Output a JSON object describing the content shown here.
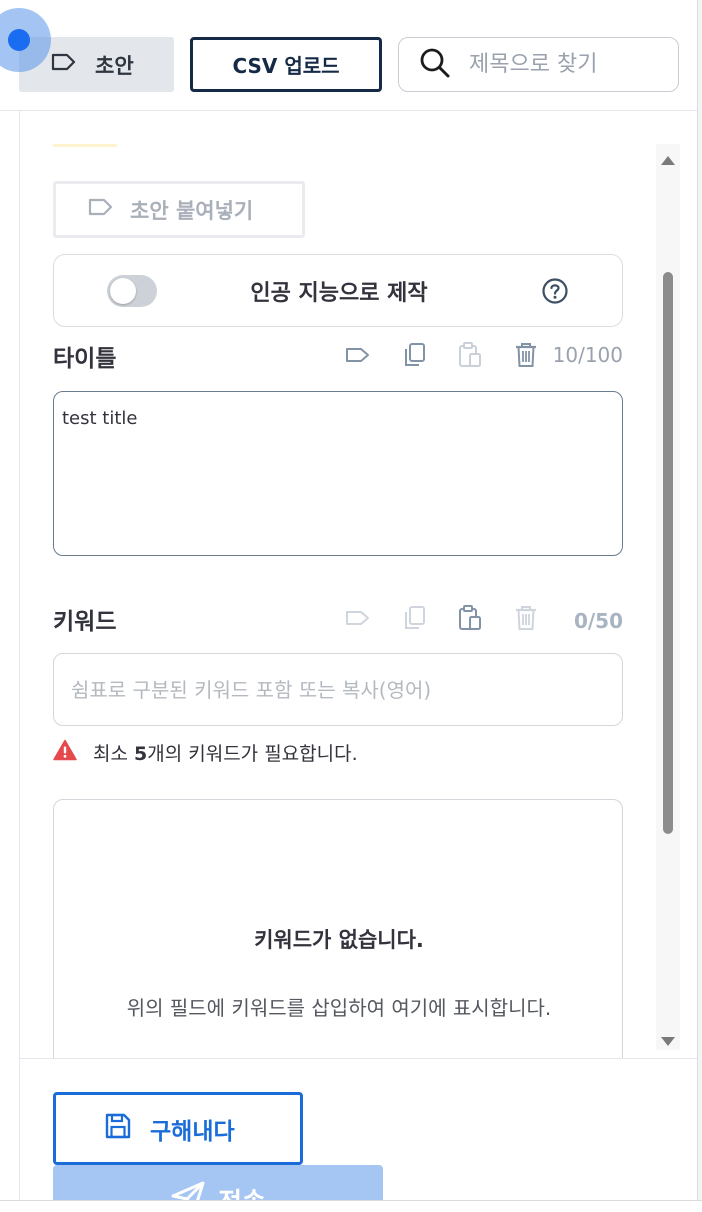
{
  "toolbar": {
    "draft_label": "초안",
    "csv_label": "CSV 업로드",
    "search_placeholder": "제목으로 찾기"
  },
  "draft_tools": {
    "paste_draft_label": "초안 붙여넣기"
  },
  "ai": {
    "label": "인공 지능으로 제작",
    "enabled": false
  },
  "title_section": {
    "heading": "타이틀",
    "counter": "10/100",
    "value": "test title"
  },
  "keyword_section": {
    "heading": "키워드",
    "counter": "0/50",
    "placeholder": "쉼표로 구분된 키워드 포함 또는 복사(영어)",
    "warning_prefix": "최소 ",
    "warning_count": "5",
    "warning_suffix": "개의 키워드가 필요합니다.",
    "empty_title": "키워드가 없습니다.",
    "empty_desc": "위의 필드에 키워드를 삽입하여 여기에 표시합니다."
  },
  "footer": {
    "save_label": "구해내다",
    "submit_label": "전송"
  },
  "colors": {
    "primary": "#1a6cd8",
    "dark_navy": "#142a46",
    "warning_red": "#e5484d",
    "icon_gray": "#a9b4c2"
  },
  "icons": {
    "draft": "tag-icon",
    "search": "search-icon",
    "help": "question-circle-icon",
    "copy": "copy-icon",
    "paste": "clipboard-icon",
    "delete": "trash-icon",
    "warning": "warning-triangle-icon",
    "save": "floppy-disk-icon",
    "submit": "paper-plane-icon"
  }
}
